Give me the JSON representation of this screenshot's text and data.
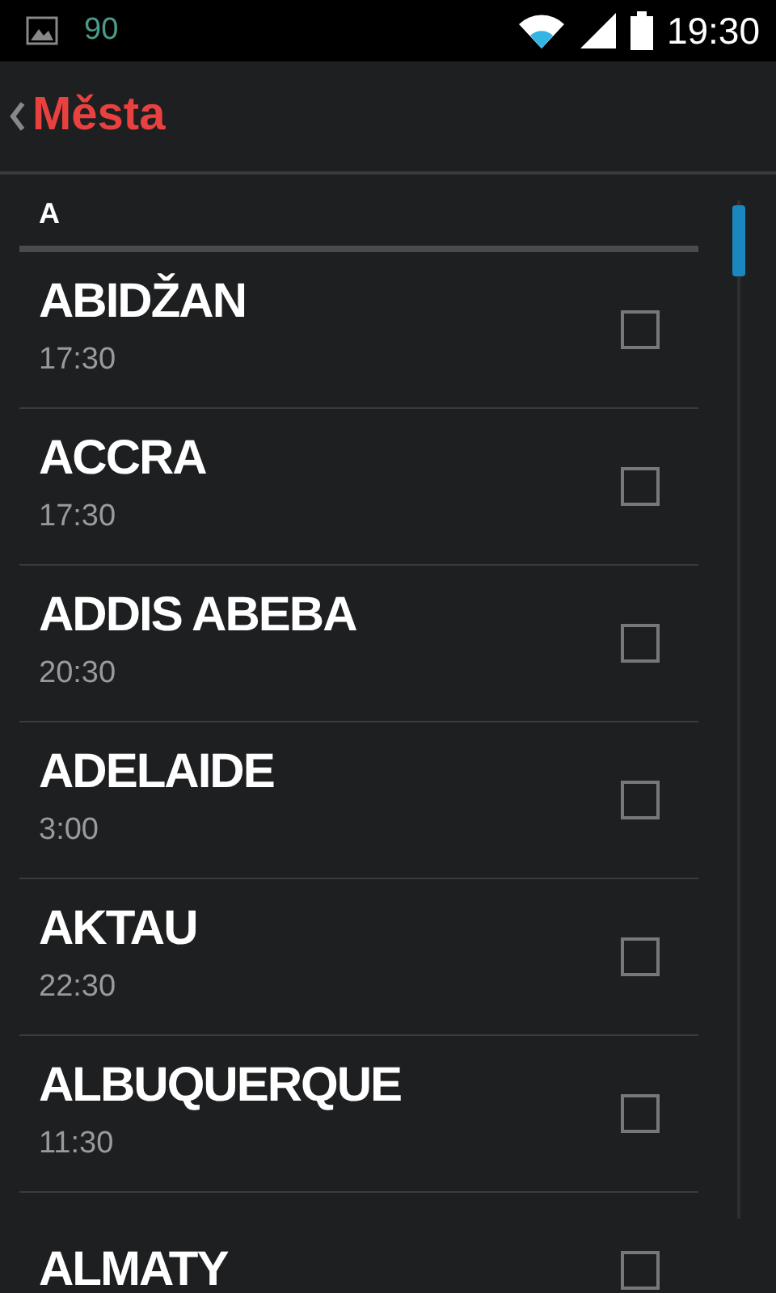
{
  "status_bar": {
    "notification_count": "90",
    "time": "19:30"
  },
  "action_bar": {
    "title": "Města"
  },
  "section": {
    "header": "A"
  },
  "cities": [
    {
      "name": "ABIDŽAN",
      "time": "17:30",
      "checked": false
    },
    {
      "name": "ACCRA",
      "time": "17:30",
      "checked": false
    },
    {
      "name": "ADDIS ABEBA",
      "time": "20:30",
      "checked": false
    },
    {
      "name": "ADELAIDE",
      "time": "3:00",
      "checked": false
    },
    {
      "name": "AKTAU",
      "time": "22:30",
      "checked": false
    },
    {
      "name": "ALBUQUERQUE",
      "time": "11:30",
      "checked": false
    },
    {
      "name": "ALMATY",
      "checked": false
    }
  ]
}
